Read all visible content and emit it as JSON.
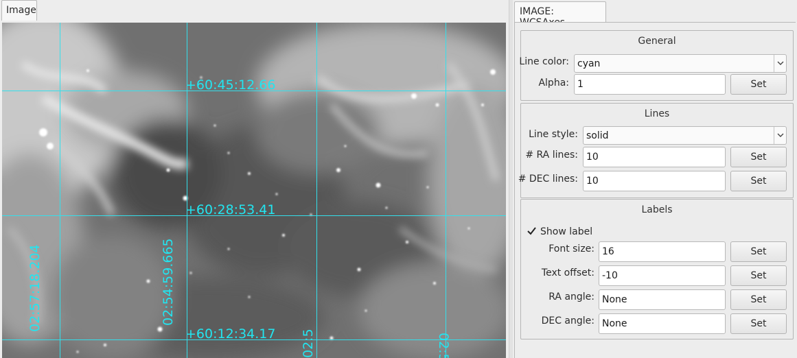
{
  "image_tab": {
    "label": "Image"
  },
  "wcs_labels": {
    "dec_top": "+60:45:12.66",
    "dec_mid": "+60:28:53.41",
    "dec_bottom": "+60:12:34.17",
    "ra_left": "02:57:18.204",
    "ra_center": "02:54:59.665",
    "ra_right1": "02:5",
    "ra_right2": "02:5"
  },
  "grid_color": "#33e0ec",
  "panel": {
    "tab_label": "IMAGE: WCSAxes",
    "general": {
      "title": "General",
      "line_color_label": "Line color:",
      "line_color_value": "cyan",
      "alpha_label": "Alpha:",
      "alpha_value": "1",
      "set_label": "Set"
    },
    "lines": {
      "title": "Lines",
      "line_style_label": "Line style:",
      "line_style_value": "solid",
      "ra_lines_label": "# RA lines:",
      "ra_lines_value": "10",
      "dec_lines_label": "# DEC lines:",
      "dec_lines_value": "10",
      "set_label": "Set"
    },
    "labels": {
      "title": "Labels",
      "show_label_label": "Show label",
      "show_label_checked": true,
      "font_size_label": "Font size:",
      "font_size_value": "16",
      "text_offset_label": "Text offset:",
      "text_offset_value": "-10",
      "ra_angle_label": "RA angle:",
      "ra_angle_value": "None",
      "dec_angle_label": "DEC angle:",
      "dec_angle_value": "None",
      "set_label": "Set"
    }
  },
  "icons": {
    "combo_arrow": "chevron-down-icon",
    "check": "checkmark-icon"
  }
}
